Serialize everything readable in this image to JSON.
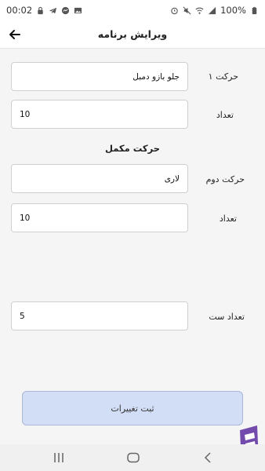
{
  "status_bar": {
    "time": "00:02",
    "battery": "100%",
    "left_icons": [
      "lock-icon",
      "telegram-icon",
      "messenger-icon",
      "gallery-icon"
    ],
    "right_icons": [
      "alarm-icon",
      "mute-icon",
      "wifi-icon",
      "signal-icon",
      "battery-icon"
    ]
  },
  "app_bar": {
    "title": "ویرایش برنامه",
    "back_icon": "arrow-left-icon"
  },
  "form": {
    "move1": {
      "label": "حرکت ۱",
      "value": "جلو بازو دمبل"
    },
    "count1": {
      "label": "تعداد",
      "value": "10"
    },
    "complement_heading": "حرکت مکمل",
    "move2": {
      "label": "حرکت دوم",
      "value": "لاری"
    },
    "count2": {
      "label": "تعداد",
      "value": "10"
    },
    "sets": {
      "label": "تعداد ست",
      "value": "5"
    }
  },
  "submit": {
    "label": "ثبت تغییرات"
  },
  "nav_bar": {
    "icons": [
      "recents-icon",
      "home-icon",
      "back-icon"
    ]
  },
  "colors": {
    "background": "#f5f5f5",
    "button_fill": "#d2def5",
    "button_border": "#aab8d6",
    "field_border": "#cfcfcf",
    "watermark": "#5b2da0"
  }
}
